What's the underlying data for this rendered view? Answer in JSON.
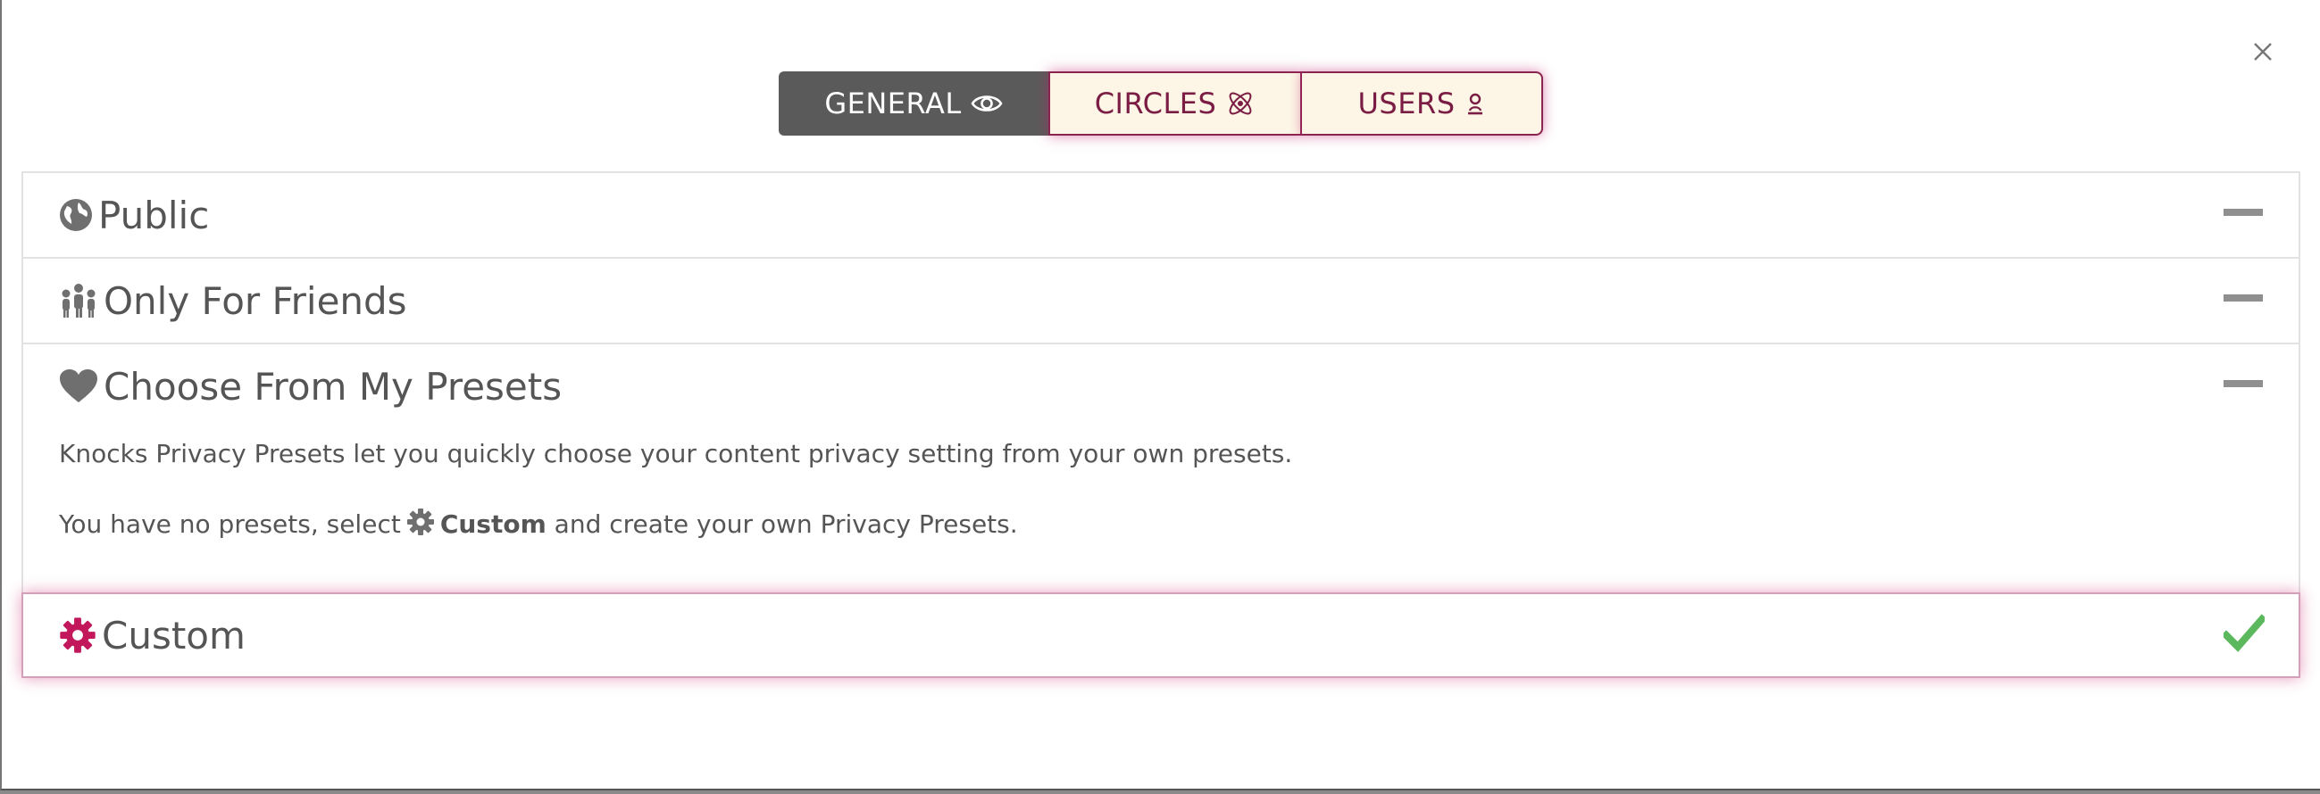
{
  "tabs": {
    "general": {
      "label": "GENERAL",
      "icon": "eye-icon"
    },
    "circles": {
      "label": "CIRCLES",
      "icon": "atom-icon"
    },
    "users": {
      "label": "USERS",
      "icon": "user-icon"
    }
  },
  "panels": [
    {
      "title": "Public",
      "icon": "globe-icon",
      "state": "collapsed"
    },
    {
      "title": "Only For Friends",
      "icon": "group-icon",
      "state": "collapsed"
    },
    {
      "title": "Choose From My Presets",
      "icon": "heart-icon",
      "state": "expanded",
      "body": {
        "line1": "Knocks Privacy Presets let you quickly choose your content privacy setting from your own presets.",
        "line2_prefix": "You have no presets, select",
        "line2_link": "Custom",
        "line2_suffix": "and create your own Privacy Presets."
      }
    },
    {
      "title": "Custom",
      "icon": "gear-icon",
      "state": "selected"
    }
  ],
  "colors": {
    "accent": "#c2185b",
    "tab_active_bg": "#5a5a5a",
    "tab_inactive_bg": "#fdf6e6",
    "tab_inactive_text": "#7a1c44",
    "check": "#5cb85c",
    "icon_gray": "#6f6f6f"
  }
}
